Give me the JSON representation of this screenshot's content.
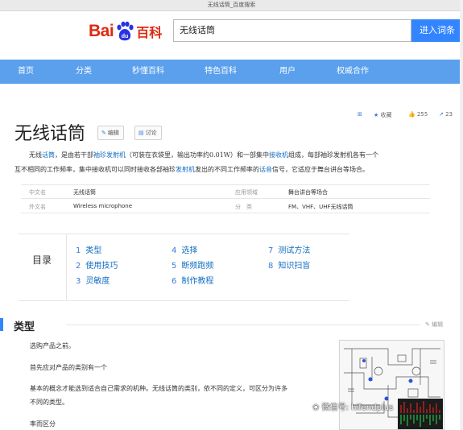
{
  "browser": {
    "tab_title": "无线话筒_百度搜索"
  },
  "header": {
    "logo_text": "Bai",
    "logo_du": "du",
    "logo_baike": "百科",
    "search_value": "无线话筒",
    "search_button": "进入词条"
  },
  "nav": {
    "items": [
      "首页",
      "分类",
      "秒懂百科",
      "特色百科",
      "用户",
      "权威合作"
    ]
  },
  "entry": {
    "title": "无线话筒",
    "edit_label": "编辑",
    "discuss_label": "讨论",
    "collect_label": "收藏",
    "like_count": "255",
    "share_count": "23"
  },
  "summary": {
    "p1_pre": "无线",
    "p1_link1": "话筒",
    "p1_mid1": "，是由若干部",
    "p1_link2": "袖珍发射机",
    "p1_mid2": "（可装在衣袋里，输出功率约0.01W）和一部集中",
    "p1_link3": "接收机",
    "p1_mid3": "组成，每部袖珍发射机各有一个",
    "p2_pre": "互不相同的工作频率，集中接收机可以同时接收各部袖珍",
    "p2_link1": "发射机",
    "p2_mid": "发出的不同工作频率的",
    "p2_link2": "话音",
    "p2_end": "信号，它适应于舞台讲台等场合。"
  },
  "basic_info": [
    {
      "key": "中文名",
      "value": "无线话筒"
    },
    {
      "key": "应用领域",
      "value": "舞台讲台等场合"
    },
    {
      "key": "外文名",
      "value": "Wireless microphone"
    },
    {
      "key": "分　类",
      "value": "FM、VHF、UHF无线话筒"
    }
  ],
  "toc": {
    "title": "目录",
    "items": [
      {
        "num": "1",
        "label": "类型"
      },
      {
        "num": "2",
        "label": "使用技巧"
      },
      {
        "num": "3",
        "label": "灵敏度"
      },
      {
        "num": "4",
        "label": "选择"
      },
      {
        "num": "5",
        "label": "断频跑频"
      },
      {
        "num": "6",
        "label": "制作教程"
      },
      {
        "num": "7",
        "label": "测试方法"
      },
      {
        "num": "8",
        "label": "知识扫盲"
      }
    ]
  },
  "section": {
    "title": "类型",
    "edit_label": "编辑",
    "lines": [
      "选购产品之前。",
      "首先应对产品的类别有一个",
      "基本的概念才能选到适合自己需求的机种。无线话筒的类别，依不同的定义，可区分为许多",
      "不同的类型。",
      "率而区分"
    ]
  },
  "watermark": "微信号: hifendplus",
  "colors": {
    "brand_red": "#de2910",
    "nav_blue": "#5aa0ed",
    "link_blue": "#136ec2",
    "button_blue": "#3385ff"
  }
}
